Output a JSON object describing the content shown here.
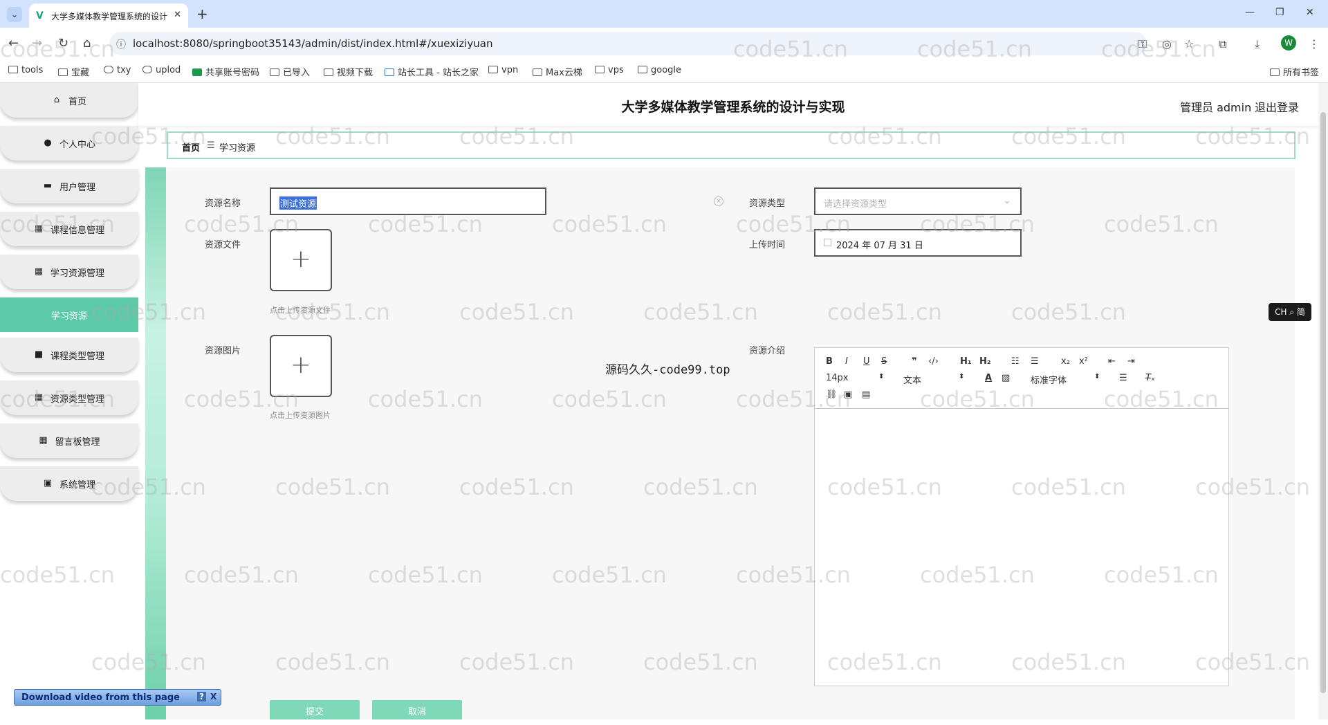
{
  "browser": {
    "tab_title": "大学多媒体教学管理系统的设计",
    "url": "localhost:8080/springboot35143/admin/dist/index.html#/xuexiziyuan",
    "profile_initial": "W",
    "bookmarks": [
      "tools",
      "宝藏",
      "txy",
      "uplod",
      "共享账号密码",
      "已导入",
      "视频下载",
      "站长工具 - 站长之家",
      "vpn",
      "Max云梯",
      "vps",
      "google"
    ],
    "all_bookmarks": "所有书签"
  },
  "app": {
    "title": "大学多媒体教学管理系统的设计与实现",
    "user": "管理员 admin",
    "logout": "退出登录"
  },
  "sidebar": {
    "items": [
      {
        "label": "首页",
        "icon": "home-icon"
      },
      {
        "label": "个人中心",
        "icon": "user-icon"
      },
      {
        "label": "用户管理",
        "icon": "chat-icon"
      },
      {
        "label": "课程信息管理",
        "icon": "grid-icon"
      },
      {
        "label": "学习资源管理",
        "icon": "grid-icon"
      },
      {
        "label": "学习资源",
        "icon": "",
        "active": true
      },
      {
        "label": "课程类型管理",
        "icon": "video-icon"
      },
      {
        "label": "资源类型管理",
        "icon": "grid-icon"
      },
      {
        "label": "留言板管理",
        "icon": "grid-icon"
      },
      {
        "label": "系统管理",
        "icon": "system-icon"
      }
    ]
  },
  "breadcrumb": {
    "home": "首页",
    "current": "学习资源"
  },
  "form": {
    "name_label": "资源名称",
    "name_value": "测试资源",
    "type_label": "资源类型",
    "type_placeholder": "请选择资源类型",
    "file_label": "资源文件",
    "file_hint": "点击上传资源文件",
    "time_label": "上传时间",
    "time_value": "2024 年 07 月 31 日",
    "image_label": "资源图片",
    "image_hint": "点击上传资源图片",
    "intro_label": "资源介绍",
    "submit": "提交",
    "cancel": "取消"
  },
  "editor": {
    "font_size": "14px",
    "block_type": "文本",
    "font_family": "标准字体"
  },
  "overlay_text": "源码久久-code99.top",
  "ime": "CH ⌕ 简",
  "download_bar": {
    "text": "Download video from this page",
    "help": "?",
    "close": "X"
  },
  "watermark": "code51.cn"
}
